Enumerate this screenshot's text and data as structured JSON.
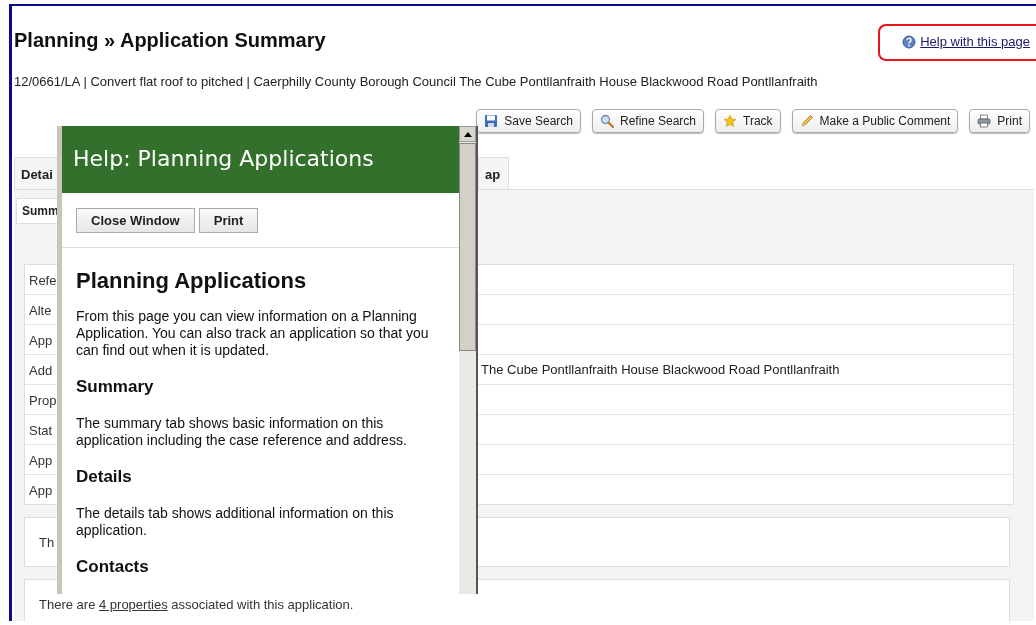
{
  "header": {
    "title": "Planning » Application Summary",
    "subtitle": "12/0661/LA | Convert flat roof to pitched | Caerphilly County Borough Council The Cube Pontllanfraith House Blackwood Road Pontllanfraith"
  },
  "help_link": {
    "label": "Help with this page",
    "highlighted": true
  },
  "toolbar": [
    {
      "label": "Save Search",
      "kind": "save"
    },
    {
      "label": "Refine Search",
      "kind": "search"
    },
    {
      "label": "Track",
      "kind": "star"
    },
    {
      "label": "Make a Public Comment",
      "kind": "pencil"
    },
    {
      "label": "Print",
      "kind": "print"
    }
  ],
  "tabs": [
    {
      "label": "Detai",
      "selected": false
    },
    {
      "label": "ap",
      "selected": false
    }
  ],
  "subtabs": [
    {
      "label": "Summ",
      "selected": true
    }
  ],
  "summary_rows": [
    {
      "label": "Refe"
    },
    {
      "label": "Alte"
    },
    {
      "label": "App"
    },
    {
      "label": "Add",
      "value": "The Cube Pontllanfraith House Blackwood Road Pontllanfraith"
    },
    {
      "label": "Prop"
    },
    {
      "label": "Stat"
    },
    {
      "label": "App"
    },
    {
      "label": "App"
    }
  ],
  "notes": [
    {
      "text": "Th"
    },
    {
      "before": "There are ",
      "link": "4 properties",
      "after": " associated with this application."
    }
  ],
  "help_window": {
    "title": "Help: Planning Applications",
    "buttons": [
      "Close Window",
      "Print"
    ],
    "heading": "Planning Applications",
    "intro": "From this page you can view information on a Planning Application. You can also track an application so that you can find out when it is updated.",
    "sections": [
      {
        "heading": "Summary",
        "text": "The summary tab shows basic information on this application including the case reference and address."
      },
      {
        "heading": "Details",
        "text": "The details tab shows additional information on this application."
      },
      {
        "heading": "Contacts"
      }
    ]
  }
}
